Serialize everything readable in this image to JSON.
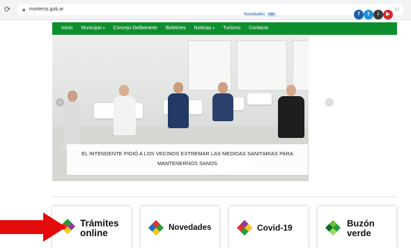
{
  "browser": {
    "url": "morteros.gob.ar"
  },
  "header": {
    "notice_text": "Novedades",
    "notice_link": "Ver"
  },
  "nav": {
    "items": [
      {
        "label": "Inicio",
        "dropdown": false
      },
      {
        "label": "Municipio",
        "dropdown": true
      },
      {
        "label": "Concejo Deliberante",
        "dropdown": false
      },
      {
        "label": "Boletines",
        "dropdown": false
      },
      {
        "label": "Noticias",
        "dropdown": true
      },
      {
        "label": "Turismo",
        "dropdown": false
      },
      {
        "label": "Contacto",
        "dropdown": false
      }
    ],
    "caret": "▾"
  },
  "carousel": {
    "caption": "EL INTENDENTE PIDIÓ A LOS VECINOS EXTREMAR LAS MEDIDAS SANITARIAS PARA MANTENERNOS SANOS",
    "prev": "‹",
    "next": "›"
  },
  "social": {
    "facebook": "f",
    "twitter": "t",
    "instagram": "i",
    "youtube": "▶"
  },
  "cards": [
    {
      "label": "Trámites online"
    },
    {
      "label": "Novedades"
    },
    {
      "label": "Covid-19"
    },
    {
      "label": "Buzón verde"
    }
  ],
  "colors": {
    "nav": "#0e8f2e",
    "arrow": "#e30b0b",
    "logo_green": "#1f9e3a",
    "logo_red": "#e6322b",
    "logo_yellow": "#f4c51b",
    "logo_blue": "#1e6fc1",
    "logo_purple": "#8a3f9c"
  }
}
